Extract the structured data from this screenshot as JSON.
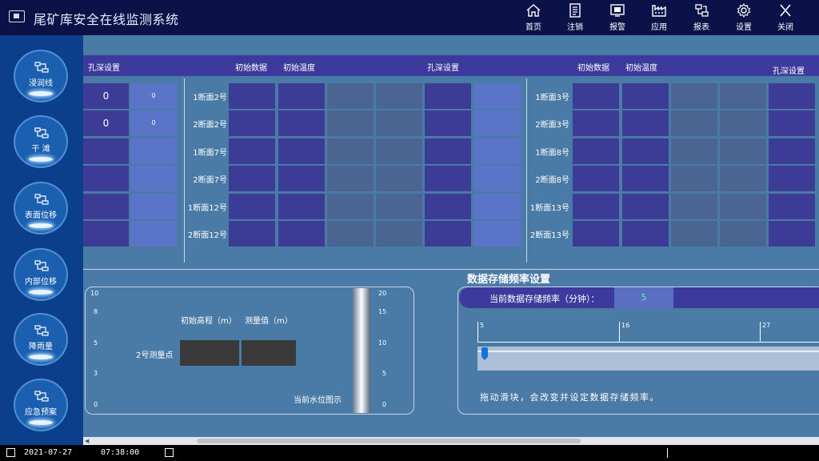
{
  "header": {
    "title": "尾矿库安全在线监测系统",
    "buttons": [
      {
        "id": "home",
        "label": "首页",
        "icon": "home-icon"
      },
      {
        "id": "logout",
        "label": "注销",
        "icon": "document-icon"
      },
      {
        "id": "alarm",
        "label": "报警",
        "icon": "alarm-monitor-icon"
      },
      {
        "id": "apps",
        "label": "应用",
        "icon": "factory-icon"
      },
      {
        "id": "reports",
        "label": "报表",
        "icon": "network-icon"
      },
      {
        "id": "settings",
        "label": "设置",
        "icon": "gear-icon"
      },
      {
        "id": "close",
        "label": "关闭",
        "icon": "close-icon"
      }
    ]
  },
  "sidebar": {
    "items": [
      {
        "label": "浸润线"
      },
      {
        "label": "干 滩"
      },
      {
        "label": "表面位移"
      },
      {
        "label": "内部位移"
      },
      {
        "label": "降雨量"
      },
      {
        "label": "应急预案"
      }
    ]
  },
  "table": {
    "headers": {
      "hole_depth_1": "孔深设置",
      "initial_data_1": "初始数据",
      "initial_temp_1": "初始温度",
      "hole_depth_2": "孔深设置",
      "initial_data_2": "初始数据",
      "initial_temp_2": "初始温度",
      "hole_depth_3": "孔深设置"
    },
    "left_values": [
      {
        "depth": "0",
        "small": "0"
      },
      {
        "depth": "0",
        "small": "0"
      },
      {
        "depth": "",
        "small": ""
      },
      {
        "depth": "",
        "small": ""
      },
      {
        "depth": "",
        "small": ""
      },
      {
        "depth": "",
        "small": ""
      }
    ],
    "middle_rows": [
      "1断面2号",
      "2断面2号",
      "1断面7号",
      "2断面7号",
      "1断面12号",
      "2断面12号"
    ],
    "right_rows": [
      "1断面3号",
      "2断面3号",
      "1断面8号",
      "2断面8号",
      "1断面13号",
      "2断面13号"
    ]
  },
  "gauge": {
    "left_ticks": [
      "10",
      "8",
      "5",
      "3",
      "0"
    ],
    "right_ticks": [
      "20",
      "15",
      "10",
      "5",
      "0"
    ],
    "initial_elevation_label": "初始高程（m）",
    "measured_value_label": "测量值（m）",
    "point_label": "2号测量点",
    "water_level_label": "当前水位图示"
  },
  "frequency": {
    "title": "数据存储频率设置",
    "current_label": "当前数据存储频率（分钟）：",
    "current_value": "5",
    "ruler_labels": [
      "5",
      "16",
      "27"
    ],
    "help_text": "拖动滑块，会改变并设定数据存储频率。"
  },
  "statusbar": {
    "date": "2021-07-27",
    "time": "07:38:00"
  },
  "colors": {
    "header_bg": "#0a1248",
    "sidebar_bg": "#0b3f8c",
    "content_bg": "#4a7aa6",
    "band": "#3d3a9e",
    "cell_indigo": "#3c3b96",
    "cell_light": "#5a74c8",
    "cell_slate": "#4a6592",
    "value_green": "#6ef0a0"
  }
}
